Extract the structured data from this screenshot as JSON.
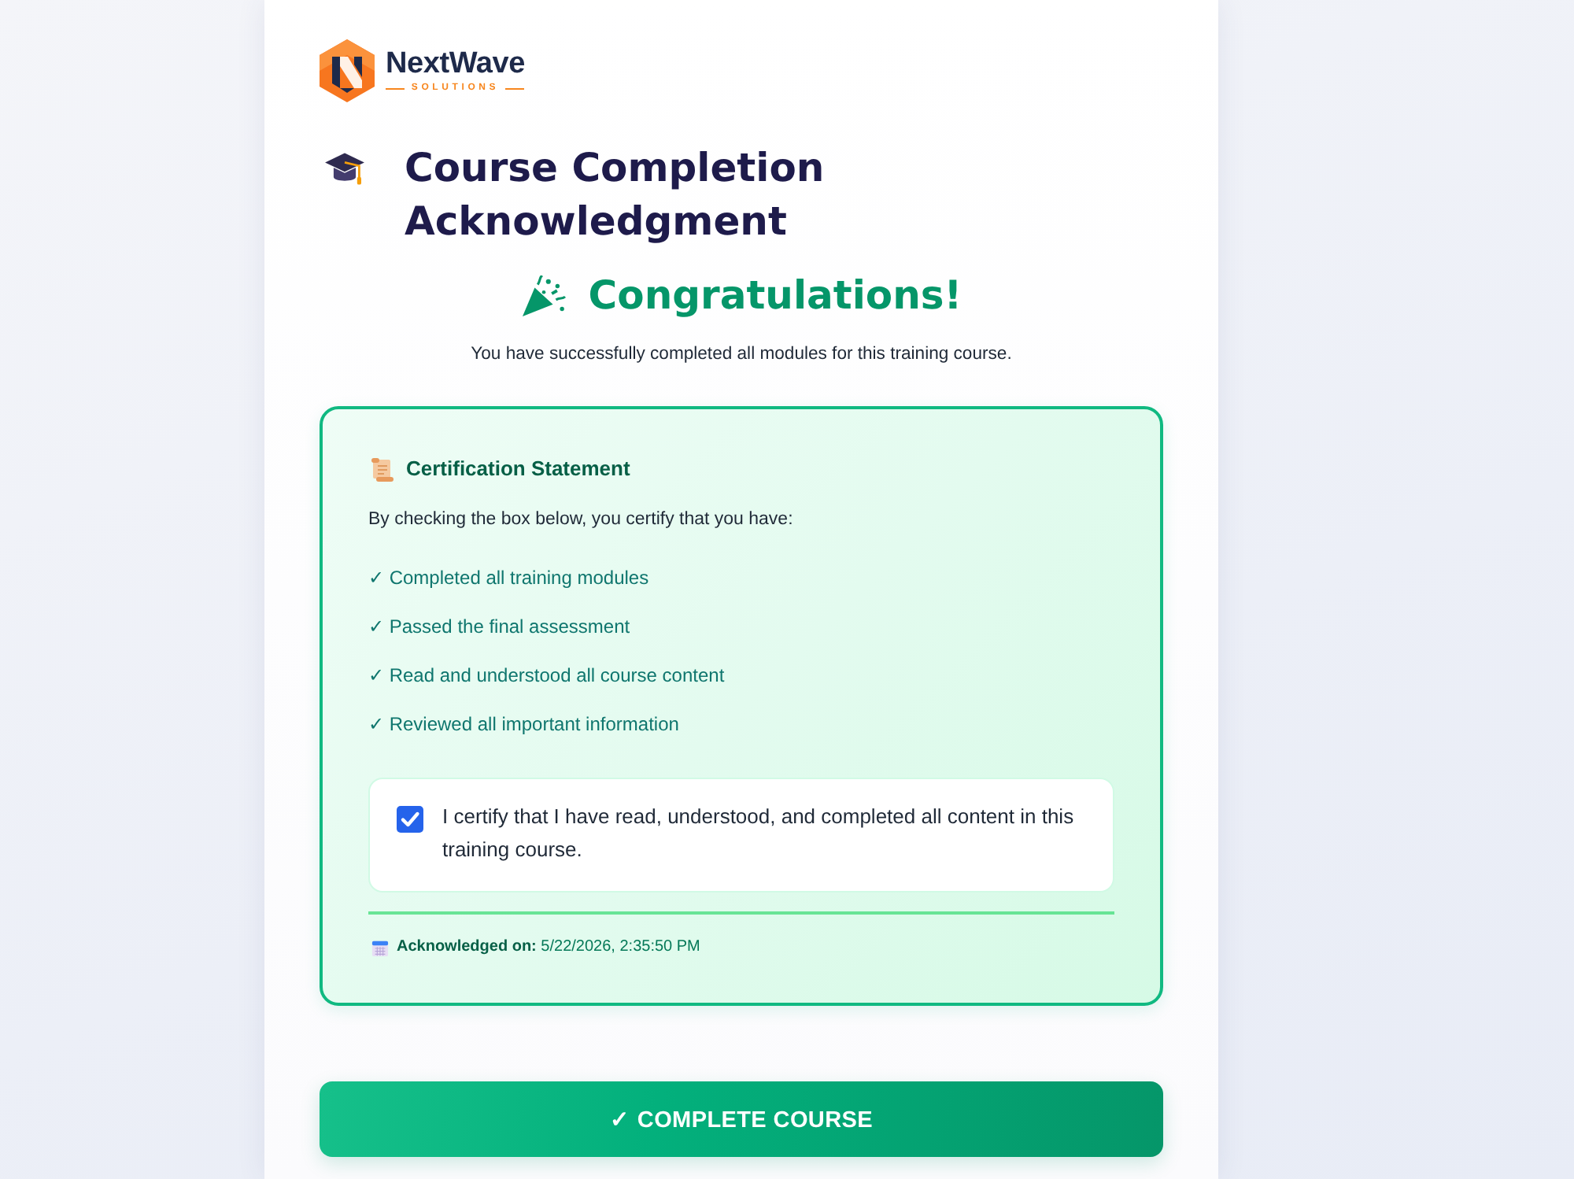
{
  "logo": {
    "name": "NextWave",
    "tagline": "SOLUTIONS"
  },
  "title": "Course Completion Acknowledgment",
  "congratulations": {
    "heading": "Congratulations!",
    "message": "You have successfully completed all modules for this training course."
  },
  "certification": {
    "heading": "Certification Statement",
    "intro": "By checking the box below, you certify that you have:",
    "items": [
      "✓ Completed all training modules",
      "✓ Passed the final assessment",
      "✓ Read and understood all course content",
      "✓ Reviewed all important information"
    ],
    "agreement": {
      "label": "I certify that I have read, understood, and completed all content in this training course.",
      "checked": true
    },
    "acknowledged": "**Acknowledged on:** 5/22/2026, 2:35:50 PM"
  },
  "button": {
    "label": "✓ COMPLETE COURSE"
  }
}
